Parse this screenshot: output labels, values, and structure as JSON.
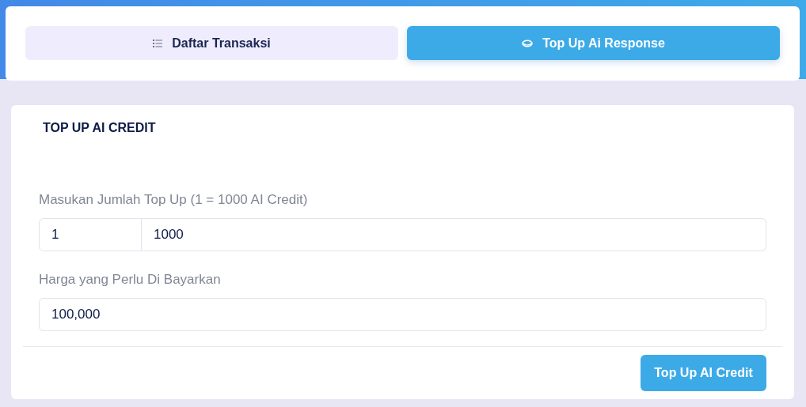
{
  "tabs": [
    {
      "label": "Daftar Transaksi",
      "kind": "list",
      "selected": false
    },
    {
      "label": "Top Up Ai Response",
      "kind": "coin",
      "selected": true
    }
  ],
  "form": {
    "title": "TOP UP AI CREDIT",
    "amount": {
      "label": "Masukan Jumlah Top Up (1 = 1000 AI Credit)",
      "quantity": "1",
      "credit": "1000"
    },
    "price": {
      "label": "Harga yang Perlu Di Bayarkan",
      "value": "100,000"
    },
    "submit": "Top Up AI Credit"
  }
}
